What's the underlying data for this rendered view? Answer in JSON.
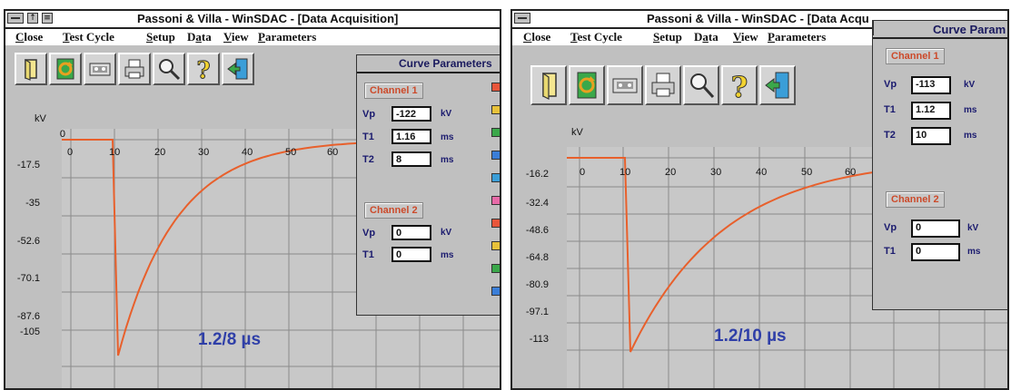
{
  "left_window": {
    "title": "Passoni & Villa - WinSDAC - [Data Acquisition]",
    "menu": [
      {
        "accel": "C",
        "rest": "lose"
      },
      {
        "accel": "T",
        "rest": "est Cycle"
      },
      {
        "accel": "S",
        "rest": "etup"
      },
      {
        "pre": "D",
        "accel": "a",
        "rest": "ta"
      },
      {
        "accel": "V",
        "rest": "iew"
      },
      {
        "accel": "P",
        "rest": "arameters"
      }
    ],
    "toolbar_icons": [
      "open-file-icon",
      "refresh-cycle-icon",
      "tape-icon",
      "printer-icon",
      "zoom-icon",
      "help-icon",
      "exit-icon"
    ],
    "plot": {
      "y_unit": "kV",
      "y_ticks": [
        "0",
        "-17.5",
        "-35",
        "-52.6",
        "-70.1",
        "-87.6",
        "-105"
      ],
      "x_ticks": [
        "0",
        "10",
        "20",
        "30",
        "40",
        "50",
        "60"
      ],
      "annotation": "1.2/8 µs"
    },
    "panel": {
      "title": "Curve Parameters",
      "channel1_label": "Channel 1",
      "vp_label": "Vp",
      "vp_value": "-122",
      "vp_unit": "kV",
      "t1_label": "T1",
      "t1_value": "1.16",
      "t1_unit": "ms",
      "t2_label": "T2",
      "t2_value": "8",
      "t2_unit": "ms",
      "channel2_label": "Channel 2",
      "ch2_vp_label": "Vp",
      "ch2_vp_value": "0",
      "ch2_vp_unit": "kV",
      "ch2_t1_label": "T1",
      "ch2_t1_value": "0",
      "ch2_t1_unit": "ms"
    },
    "swatch_colors": [
      "#e8553a",
      "#e8c23a",
      "#3aa84a",
      "#3a7ed8",
      "#3a9ed8",
      "#e86aa8",
      "#e8553a",
      "#e8c23a",
      "#3aa84a",
      "#3a7ed8"
    ]
  },
  "right_window": {
    "title": "Passoni & Villa - WinSDAC - [Data Acqu",
    "menu": [
      {
        "accel": "C",
        "rest": "lose"
      },
      {
        "accel": "T",
        "rest": "est Cycle"
      },
      {
        "accel": "S",
        "rest": "etup"
      },
      {
        "pre": "D",
        "accel": "a",
        "rest": "ta"
      },
      {
        "accel": "V",
        "rest": "iew"
      },
      {
        "accel": "P",
        "rest": "arameters"
      }
    ],
    "toolbar_icons": [
      "open-file-icon",
      "refresh-cycle-icon",
      "tape-icon",
      "printer-icon",
      "zoom-icon",
      "help-icon",
      "exit-icon"
    ],
    "plot": {
      "y_unit": "kV",
      "y_ticks": [
        "-16.2",
        "-32.4",
        "-48.6",
        "-64.8",
        "-80.9",
        "-97.1",
        "-113"
      ],
      "x_ticks": [
        "0",
        "10",
        "20",
        "30",
        "40",
        "50",
        "60"
      ],
      "annotation": "1.2/10 µs"
    },
    "panel": {
      "title": "Curve Param",
      "channel1_label": "Channel 1",
      "vp_label": "Vp",
      "vp_value": "-113",
      "vp_unit": "kV",
      "t1_label": "T1",
      "t1_value": "1.12",
      "t1_unit": "ms",
      "t2_label": "T2",
      "t2_value": "10",
      "t2_unit": "ms",
      "channel2_label": "Channel 2",
      "ch2_vp_label": "Vp",
      "ch2_vp_value": "0",
      "ch2_vp_unit": "kV",
      "ch2_t1_label": "T1",
      "ch2_t1_value": "0",
      "ch2_t1_unit": "ms"
    }
  },
  "colors": {
    "waveform": "#e8602c",
    "annotation": "#2f3fa8",
    "channel_label": "#cc4a2a"
  }
}
